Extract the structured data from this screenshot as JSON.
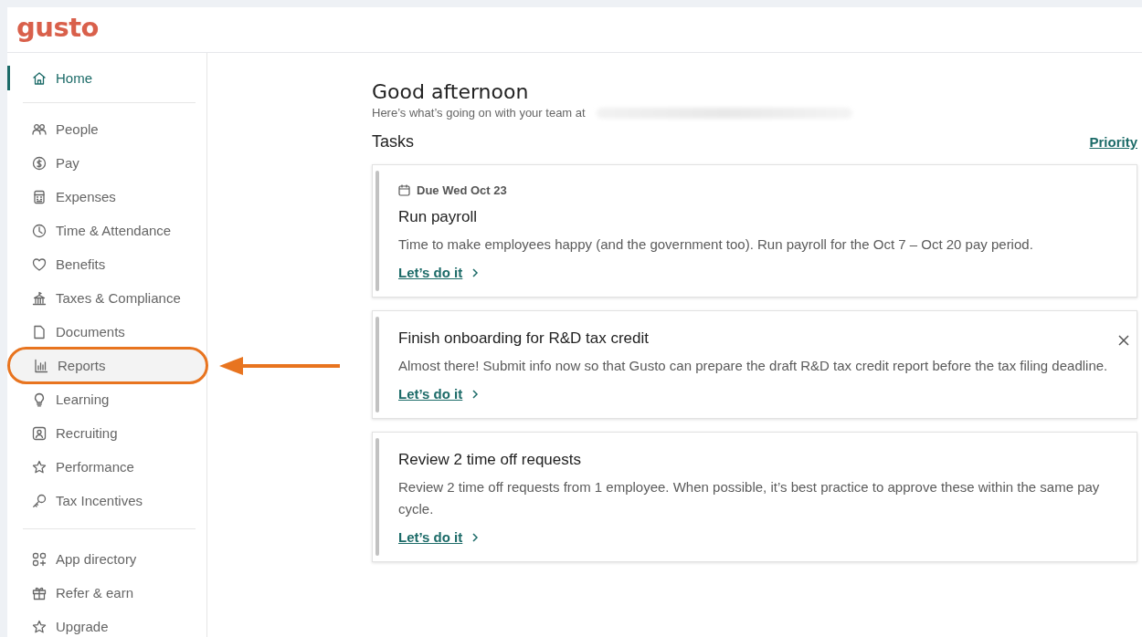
{
  "logo": "gusto",
  "sidebar": {
    "sections": [
      {
        "items": [
          {
            "label": "Home",
            "selected": true,
            "highlighted": false
          }
        ]
      },
      {
        "items": [
          {
            "label": "People",
            "selected": false,
            "highlighted": false
          },
          {
            "label": "Pay",
            "selected": false,
            "highlighted": false
          },
          {
            "label": "Expenses",
            "selected": false,
            "highlighted": false
          },
          {
            "label": "Time & Attendance",
            "selected": false,
            "highlighted": false
          },
          {
            "label": "Benefits",
            "selected": false,
            "highlighted": false
          },
          {
            "label": "Taxes & Compliance",
            "selected": false,
            "highlighted": false
          },
          {
            "label": "Documents",
            "selected": false,
            "highlighted": false
          },
          {
            "label": "Reports",
            "selected": false,
            "highlighted": true
          },
          {
            "label": "Learning",
            "selected": false,
            "highlighted": false
          },
          {
            "label": "Recruiting",
            "selected": false,
            "highlighted": false
          },
          {
            "label": "Performance",
            "selected": false,
            "highlighted": false
          },
          {
            "label": "Tax Incentives",
            "selected": false,
            "highlighted": false
          }
        ]
      },
      {
        "items": [
          {
            "label": "App directory",
            "selected": false,
            "highlighted": false
          },
          {
            "label": "Refer & earn",
            "selected": false,
            "highlighted": false
          },
          {
            "label": "Upgrade",
            "selected": false,
            "highlighted": false
          }
        ]
      }
    ]
  },
  "main": {
    "greeting": "Good afternoon",
    "subtitle": "Here’s what’s going on with your team at",
    "tasks_title": "Tasks",
    "sort_link": "Priority",
    "tasks": [
      {
        "due": "Due Wed Oct 23",
        "title": "Run payroll",
        "body": "Time to make employees happy (and the government too). Run payroll for the Oct 7 – Oct 20 pay period.",
        "action": "Let’s do it",
        "dismissible": false
      },
      {
        "title": "Finish onboarding for R&D tax credit",
        "body": "Almost there! Submit info now so that Gusto can prepare the draft R&D tax credit report before the tax filing deadline.",
        "action": "Let’s do it",
        "dismissible": true
      },
      {
        "title": "Review 2 time off requests",
        "body": "Review 2 time off requests from 1 employee. When possible, it’s best practice to approve these within the same pay cycle.",
        "action": "Let’s do it",
        "dismissible": false
      }
    ]
  }
}
